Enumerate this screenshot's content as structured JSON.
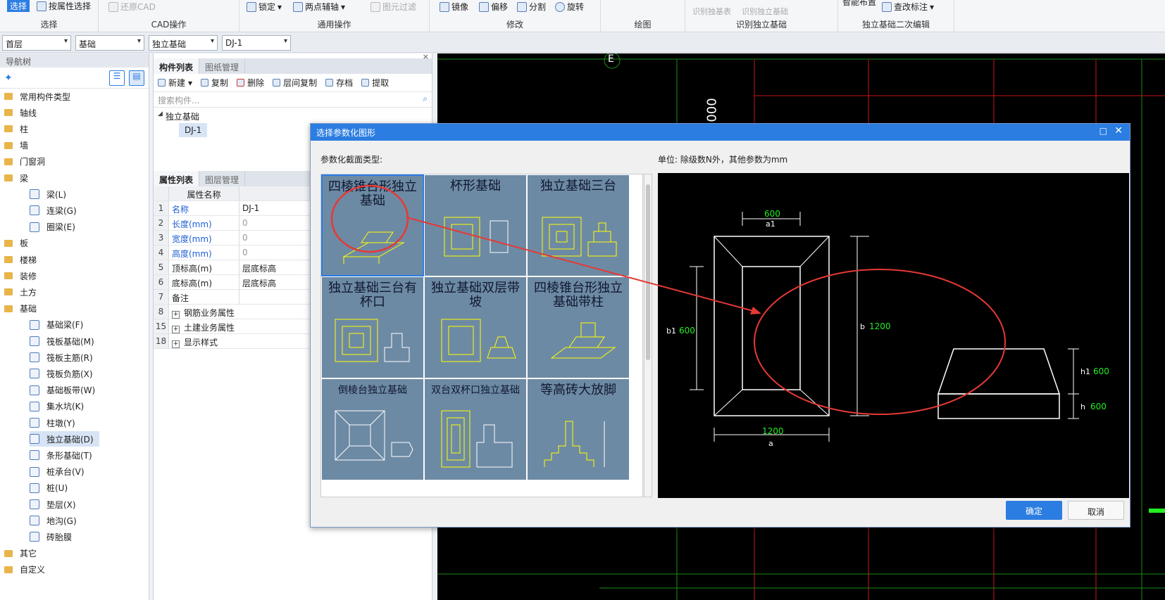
{
  "ribbon": {
    "groups": [
      {
        "title": "选择",
        "items": [
          "选择",
          "按属性选择"
        ]
      },
      {
        "title": "CAD操作",
        "items": [
          "还原CAD"
        ]
      },
      {
        "title": "通用操作",
        "items": [
          "锁定",
          "两点辅轴",
          "图元过滤"
        ]
      },
      {
        "title": "修改",
        "items": [
          "镜像",
          "偏移",
          "分割",
          "旋转"
        ]
      },
      {
        "title": "绘图",
        "items": []
      },
      {
        "title": "识别独立基础",
        "items": [
          "识别独基表",
          "识别独立基础"
        ]
      },
      {
        "title": "独立基础二次编辑",
        "items": [
          "智能布置",
          "查改标注"
        ]
      }
    ]
  },
  "combos": [
    "首层",
    "基础",
    "独立基础",
    "DJ-1"
  ],
  "nav": {
    "title": "导航树",
    "items": [
      {
        "label": "常用构件类型",
        "type": "folder"
      },
      {
        "label": "轴线",
        "type": "folder"
      },
      {
        "label": "柱",
        "type": "folder"
      },
      {
        "label": "墙",
        "type": "folder"
      },
      {
        "label": "门窗洞",
        "type": "folder"
      },
      {
        "label": "梁",
        "type": "folder"
      },
      {
        "label": "梁(L)",
        "type": "sub"
      },
      {
        "label": "连梁(G)",
        "type": "sub"
      },
      {
        "label": "圈梁(E)",
        "type": "sub"
      },
      {
        "label": "板",
        "type": "folder"
      },
      {
        "label": "楼梯",
        "type": "folder"
      },
      {
        "label": "装修",
        "type": "folder"
      },
      {
        "label": "土方",
        "type": "folder"
      },
      {
        "label": "基础",
        "type": "folder"
      },
      {
        "label": "基础梁(F)",
        "type": "sub"
      },
      {
        "label": "筏板基础(M)",
        "type": "sub"
      },
      {
        "label": "筏板主筋(R)",
        "type": "sub"
      },
      {
        "label": "筏板负筋(X)",
        "type": "sub"
      },
      {
        "label": "基础板带(W)",
        "type": "sub"
      },
      {
        "label": "集水坑(K)",
        "type": "sub"
      },
      {
        "label": "柱墩(Y)",
        "type": "sub"
      },
      {
        "label": "独立基础(D)",
        "type": "sub",
        "selected": true
      },
      {
        "label": "条形基础(T)",
        "type": "sub"
      },
      {
        "label": "桩承台(V)",
        "type": "sub"
      },
      {
        "label": "桩(U)",
        "type": "sub"
      },
      {
        "label": "垫层(X)",
        "type": "sub"
      },
      {
        "label": "地沟(G)",
        "type": "sub"
      },
      {
        "label": "砖胎膜",
        "type": "sub"
      },
      {
        "label": "其它",
        "type": "folder"
      },
      {
        "label": "自定义",
        "type": "folder"
      }
    ]
  },
  "component_panel": {
    "tabs": [
      "构件列表",
      "图纸管理"
    ],
    "toolbar": [
      "新建",
      "复制",
      "删除",
      "层间复制",
      "存档",
      "提取"
    ],
    "search_placeholder": "搜索构件...",
    "tree_root": "独立基础",
    "tree_child": "DJ-1"
  },
  "property_panel": {
    "tabs": [
      "属性列表",
      "图层管理"
    ],
    "header": "属性名称",
    "rows": [
      {
        "no": "1",
        "name": "名称",
        "value": "DJ-1",
        "blue": true
      },
      {
        "no": "2",
        "name": "长度(mm)",
        "value": "0",
        "blue": true,
        "grayval": true
      },
      {
        "no": "3",
        "name": "宽度(mm)",
        "value": "0",
        "blue": true,
        "grayval": true
      },
      {
        "no": "4",
        "name": "高度(mm)",
        "value": "0",
        "blue": true,
        "grayval": true
      },
      {
        "no": "5",
        "name": "顶标高(m)",
        "value": "层底标高"
      },
      {
        "no": "6",
        "name": "底标高(m)",
        "value": "层底标高"
      },
      {
        "no": "7",
        "name": "备注",
        "value": ""
      },
      {
        "no": "8",
        "name": "钢筋业务属性",
        "value": "",
        "expand": true
      },
      {
        "no": "15",
        "name": "土建业务属性",
        "value": "",
        "expand": true
      },
      {
        "no": "18",
        "name": "显示样式",
        "value": "",
        "expand": true
      }
    ]
  },
  "dialog": {
    "title": "选择参数化图形",
    "section_label": "参数化截面类型:",
    "unit_label": "单位:   除级数N外，其他参数为mm",
    "shapes": [
      "四棱锥台形独立基础",
      "杯形基础",
      "独立基础三台",
      "独立基础三台有杯口",
      "独立基础双层带坡",
      "四棱锥台形独立基础带柱",
      "倒棱台独立基础",
      "双台双杯口独立基础",
      "等高砖大放脚"
    ],
    "preview": {
      "top_dim": "600",
      "top_label": "a1",
      "left_label": "b1",
      "left_dim": "600",
      "right_label": "b",
      "right_dim": "1200",
      "bottom_dim": "1200",
      "bottom_label": "a",
      "h1_label": "h1",
      "h1_dim": "600",
      "h_label": "h",
      "h_dim": "600"
    },
    "ok": "确定",
    "cancel": "取消"
  },
  "canvas": {
    "axis_label": "E",
    "vertical_text": "000"
  },
  "colors": {
    "accent": "#2b7de1",
    "annot": "#e53935",
    "dim": "#22ee22"
  }
}
